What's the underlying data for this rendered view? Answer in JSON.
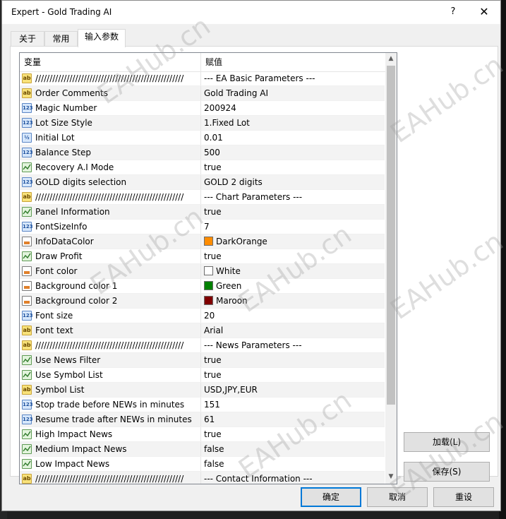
{
  "window": {
    "title": "Expert - Gold Trading AI",
    "help_glyph": "?",
    "close_glyph": "✕"
  },
  "tabs": [
    {
      "label": "关于",
      "active": false
    },
    {
      "label": "常用",
      "active": false
    },
    {
      "label": "输入参数",
      "active": true
    }
  ],
  "grid": {
    "columns": {
      "variable": "变量",
      "value": "赋值"
    },
    "rows": [
      {
        "type": "ab",
        "name": "////////////////////////////////////////////////////",
        "value": "--- EA Basic Parameters ---"
      },
      {
        "type": "ab",
        "name": "Order Comments",
        "value": "Gold Trading AI"
      },
      {
        "type": "n123",
        "name": "Magic Number",
        "value": "200924"
      },
      {
        "type": "n123",
        "name": "Lot Size Style",
        "value": "1.Fixed Lot"
      },
      {
        "type": "half",
        "name": "Initial Lot",
        "value": "0.01"
      },
      {
        "type": "n123",
        "name": "Balance Step",
        "value": "500"
      },
      {
        "type": "bool",
        "name": "Recovery A.I Mode",
        "value": "true"
      },
      {
        "type": "n123",
        "name": "GOLD digits selection",
        "value": "GOLD 2 digits"
      },
      {
        "type": "ab",
        "name": "////////////////////////////////////////////////////",
        "value": "--- Chart Parameters ---"
      },
      {
        "type": "bool",
        "name": "Panel Information",
        "value": "true"
      },
      {
        "type": "n123",
        "name": "FontSizeInfo",
        "value": "7"
      },
      {
        "type": "color",
        "name": "InfoDataColor",
        "value": "DarkOrange",
        "swatch": "#ff8c00"
      },
      {
        "type": "bool",
        "name": "Draw Profit",
        "value": "true"
      },
      {
        "type": "color",
        "name": "Font color",
        "value": "White",
        "swatch": "#ffffff"
      },
      {
        "type": "color",
        "name": "Background color 1",
        "value": "Green",
        "swatch": "#008000"
      },
      {
        "type": "color",
        "name": "Background color 2",
        "value": "Maroon",
        "swatch": "#800000"
      },
      {
        "type": "n123",
        "name": "Font size",
        "value": "20"
      },
      {
        "type": "ab",
        "name": "Font text",
        "value": "Arial"
      },
      {
        "type": "ab",
        "name": "////////////////////////////////////////////////////",
        "value": "--- News Parameters ---"
      },
      {
        "type": "bool",
        "name": "Use News Filter",
        "value": "true"
      },
      {
        "type": "bool",
        "name": "Use Symbol List",
        "value": "true"
      },
      {
        "type": "ab",
        "name": "Symbol List",
        "value": "USD,JPY,EUR"
      },
      {
        "type": "n123",
        "name": "Stop trade before NEWs in minutes",
        "value": "151"
      },
      {
        "type": "n123",
        "name": "Resume trade after NEWs in minutes",
        "value": "61"
      },
      {
        "type": "bool",
        "name": "High Impact News",
        "value": "true"
      },
      {
        "type": "bool",
        "name": "Medium Impact News",
        "value": "false"
      },
      {
        "type": "bool",
        "name": "Low Impact News",
        "value": "false"
      },
      {
        "type": "ab",
        "name": "////////////////////////////////////////////////////",
        "value": "--- Contact Information ---"
      }
    ]
  },
  "side_buttons": {
    "load": "加载(L)",
    "save": "保存(S)"
  },
  "footer_buttons": {
    "ok": "确定",
    "cancel": "取消",
    "reset": "重设"
  },
  "watermark": "EAHub.cn",
  "icon_glyphs": {
    "ab": "ab",
    "n123": "123",
    "half": "½",
    "bool": "",
    "color": ""
  },
  "colors": {
    "accent": "#0078d7"
  }
}
